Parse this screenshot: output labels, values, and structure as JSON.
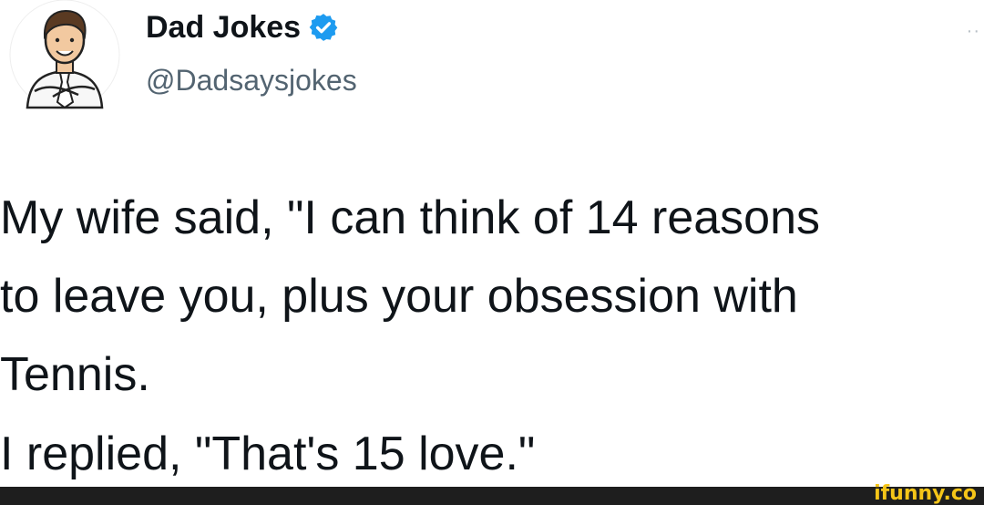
{
  "profile": {
    "display_name": "Dad Jokes",
    "handle": "@Dadsaysjokes",
    "verified": true,
    "avatar_icon": "cartoon-man-avatar-icon"
  },
  "tweet": {
    "lines": [
      "My wife said, \"I can think of 14 reasons",
      "to leave you, plus your obsession with",
      "Tennis."
    ],
    "reply": "I replied, \"That's 15 love.\""
  },
  "more_icon": "··",
  "watermark": "ifunny.co",
  "colors": {
    "verified_blue": "#1d9bf0",
    "text": "#0f1419",
    "handle_gray": "#536471",
    "watermark_yellow": "#f5c518"
  }
}
